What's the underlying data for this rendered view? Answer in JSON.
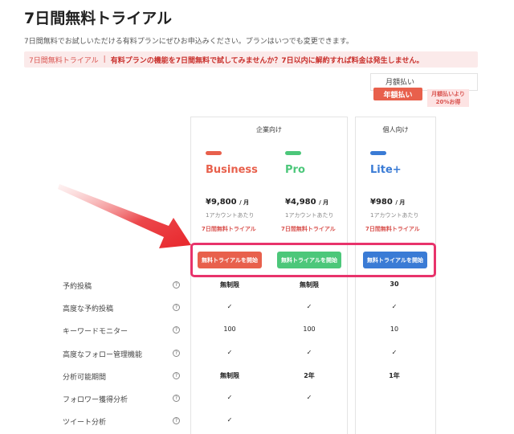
{
  "page": {
    "title": "7日間無料トライアル",
    "subtitle": "7日間無料でお試しいただける有料プランにぜひお申込みください。プランはいつでも変更できます。"
  },
  "notice": {
    "tag": "7日間無料トライアル",
    "separator": "|",
    "message": "有料プランの機能を7日間無料で試してみませんか？7日以内に解約すれば料金は発生しません。"
  },
  "billing": {
    "monthly_label": "月額払い",
    "yearly_label": "年額払い",
    "discount_line1": "月額払いより",
    "discount_line2": "20%お得"
  },
  "groups": {
    "enterprise": "企業向け",
    "personal": "個人向け"
  },
  "plans": [
    {
      "name": "Business",
      "color": "#e8604c",
      "price": "¥9,800",
      "unit": "/ 月",
      "per_account": "1アカウントあたり",
      "trial": "7日間無料トライアル",
      "cta": "無料トライアルを開始"
    },
    {
      "name": "Pro",
      "color": "#4cc77a",
      "price": "¥4,980",
      "unit": "/ 月",
      "per_account": "1アカウントあたり",
      "trial": "7日間無料トライアル",
      "cta": "無料トライアルを開始"
    },
    {
      "name": "Lite+",
      "color": "#3a7bd5",
      "price": "¥980",
      "unit": "/ 月",
      "per_account": "1アカウントあたり",
      "trial": "7日間無料トライアル",
      "cta": "無料トライアルを開始"
    }
  ],
  "features": [
    {
      "label": "予約投稿",
      "values": [
        "無制限",
        "無制限",
        "30"
      ]
    },
    {
      "label": "高度な予約投稿",
      "values": [
        "✓",
        "✓",
        "✓"
      ]
    },
    {
      "label": "キーワードモニター",
      "values": [
        "100",
        "100",
        "10"
      ]
    },
    {
      "label": "高度なフォロー管理機能",
      "values": [
        "✓",
        "✓",
        "✓"
      ]
    },
    {
      "label": "分析可能期間",
      "values": [
        "無制限",
        "2年",
        "1年"
      ]
    },
    {
      "label": "フォロワー獲得分析",
      "values": [
        "✓",
        "✓",
        ""
      ]
    },
    {
      "label": "ツイート分析",
      "values": [
        "✓",
        "",
        ""
      ]
    }
  ],
  "help_icon": {
    "icon": "question-circle-icon",
    "glyph": "?"
  },
  "arrow": {
    "icon": "arrow-pointer-icon",
    "color": "#e8262b"
  },
  "highlight_color": "#e8336b"
}
